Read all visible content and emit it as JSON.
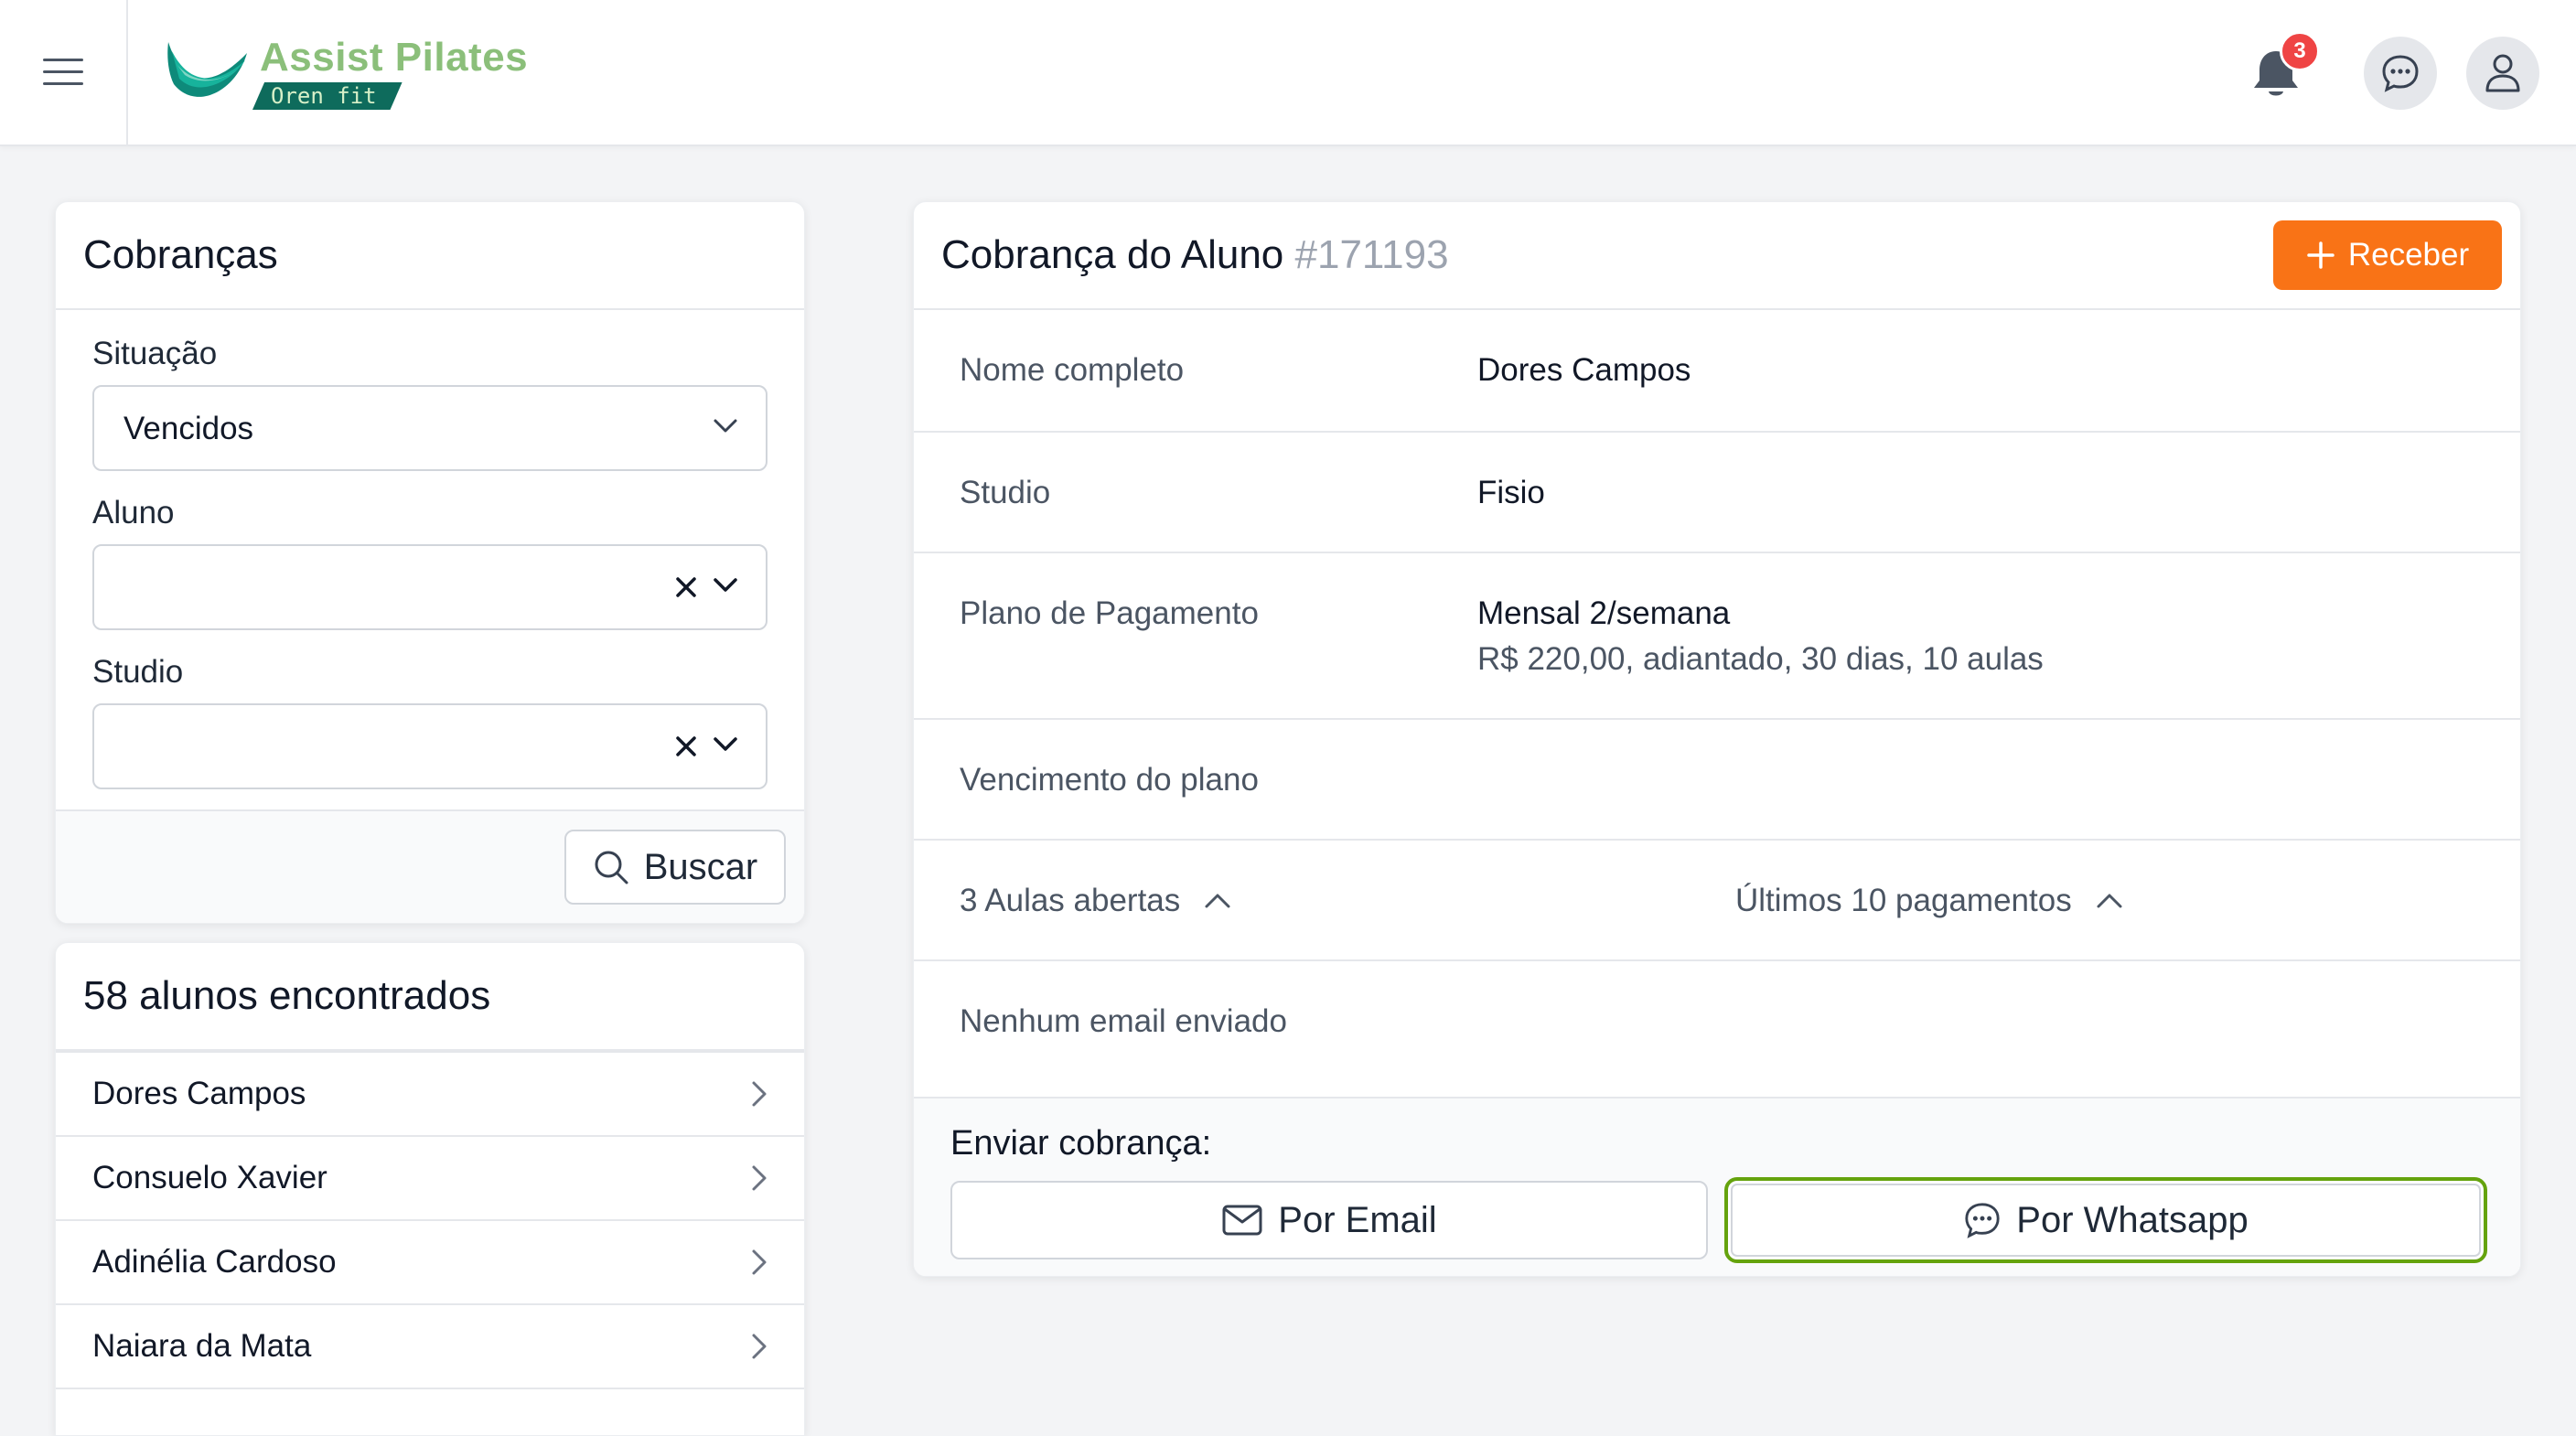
{
  "header": {
    "menu_icon": "hamburger-menu-icon",
    "brand": {
      "title": "Assist Pilates",
      "subtitle": "Oren fit",
      "colors": {
        "green": "#8bbf7a",
        "teal": "#0e6b5c"
      }
    },
    "notifications_count": "3",
    "icons": [
      "bell-icon",
      "chat-bubble-icon",
      "user-icon"
    ]
  },
  "filters": {
    "title": "Cobranças",
    "situacao": {
      "label": "Situação",
      "value": "Vencidos"
    },
    "aluno": {
      "label": "Aluno",
      "value": ""
    },
    "studio": {
      "label": "Studio",
      "value": ""
    },
    "search_button": "Buscar"
  },
  "results": {
    "title": "58 alunos encontrados",
    "items": [
      {
        "name": "Dores Campos"
      },
      {
        "name": "Consuelo Xavier"
      },
      {
        "name": "Adinélia Cardoso"
      },
      {
        "name": "Naiara da Mata"
      }
    ]
  },
  "detail": {
    "title": "Cobrança do Aluno",
    "id": "#171193",
    "receive_button": "Receber",
    "fields": {
      "nome": {
        "label": "Nome completo",
        "value": "Dores Campos"
      },
      "studio": {
        "label": "Studio",
        "value": "Fisio"
      },
      "plano": {
        "label": "Plano de Pagamento",
        "value": "Mensal 2/semana",
        "detail": "R$ 220,00, adiantado, 30 dias, 10 aulas"
      },
      "vencimento": {
        "label": "Vencimento do plano",
        "value": ""
      }
    },
    "aulas_toggle": "3 Aulas abertas",
    "pagamentos_toggle": "Últimos 10 pagamentos",
    "email_status": "Nenhum email enviado",
    "send": {
      "label": "Enviar cobrança:",
      "email_button": "Por Email",
      "whatsapp_button": "Por Whatsapp"
    },
    "colors": {
      "accent": "#f97316",
      "focus": "#65a30d"
    }
  }
}
